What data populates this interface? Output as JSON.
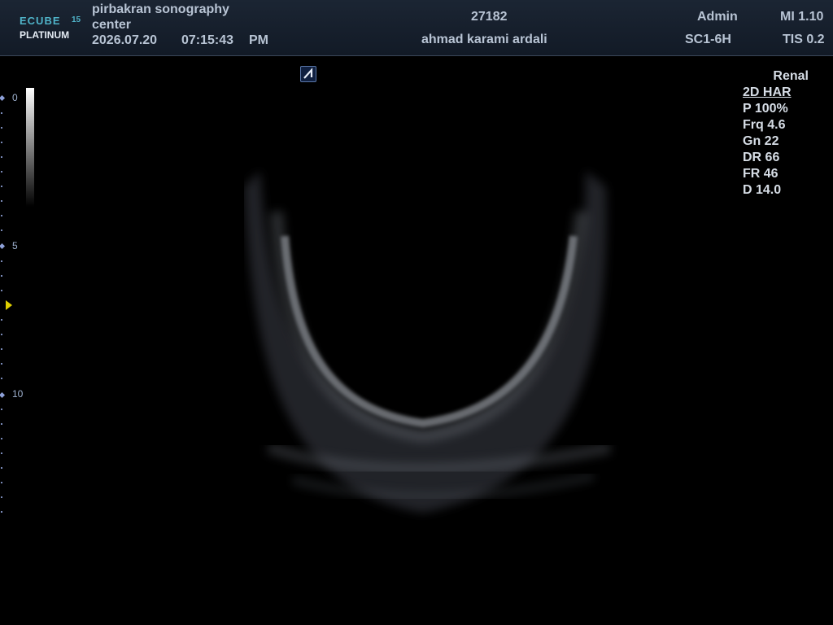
{
  "header": {
    "logo_text_top": "ECUBE",
    "logo_text_num": "15",
    "logo_text_bottom": "PLATINUM",
    "institution_line1": "pirbakran sonography",
    "institution_line2": "center",
    "date": "2026.07.20",
    "time": "07:15:43",
    "ampm": "PM",
    "patient_id": "27182",
    "patient_name": "ahmad karami ardali",
    "operator": "Admin",
    "probe": "SC1-6H",
    "mi": "MI 1.10",
    "tis": "TIS 0.2"
  },
  "depth_scale": {
    "labels": [
      "0",
      "5",
      "10"
    ]
  },
  "params": {
    "preset": "Renal",
    "mode": "2D HAR",
    "power": "P 100%",
    "frequency": "Frq 4.6",
    "gain": "Gn 22",
    "dynamic_range": "DR 66",
    "frame_rate": "FR 46",
    "depth": "D 14.0"
  },
  "colors": {
    "header_bg": "#1b2533",
    "logo_accent": "#4fb3c8",
    "focus_marker": "#e0d000",
    "scale_ticks": "#7a8ab8"
  }
}
